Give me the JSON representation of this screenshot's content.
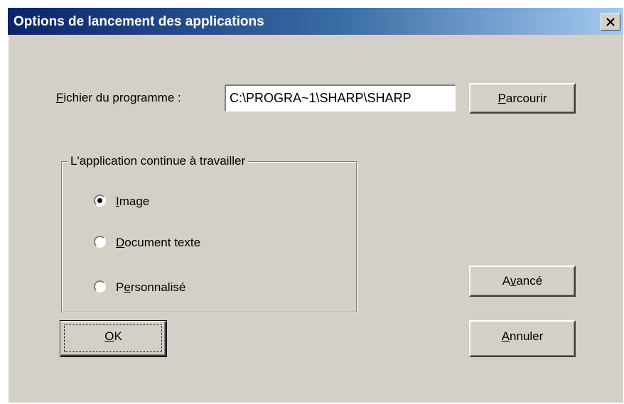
{
  "dialog": {
    "title": "Options de lancement des applications",
    "close_label": "×"
  },
  "program": {
    "label_access": "F",
    "label_rest": "ichier du programme :",
    "value": "C:\\PROGRA~1\\SHARP\\SHARP",
    "browse_access": "P",
    "browse_rest": "arcourir"
  },
  "group": {
    "legend": "L'application continue à travailler",
    "options": [
      {
        "access": "I",
        "rest": "mage",
        "selected": true
      },
      {
        "access": "D",
        "rest": "ocument texte",
        "selected": false
      },
      {
        "pre": "P",
        "access": "e",
        "rest": "rsonnalisé",
        "selected": false
      }
    ]
  },
  "buttons": {
    "advanced_pre": "A",
    "advanced_access": "v",
    "advanced_rest": "ancé",
    "ok_access": "O",
    "ok_rest": "K",
    "cancel_access": "A",
    "cancel_rest": "nnuler"
  },
  "colors": {
    "face": "#d4d0c8",
    "title_start": "#0a246a",
    "title_end": "#a6caf0"
  }
}
